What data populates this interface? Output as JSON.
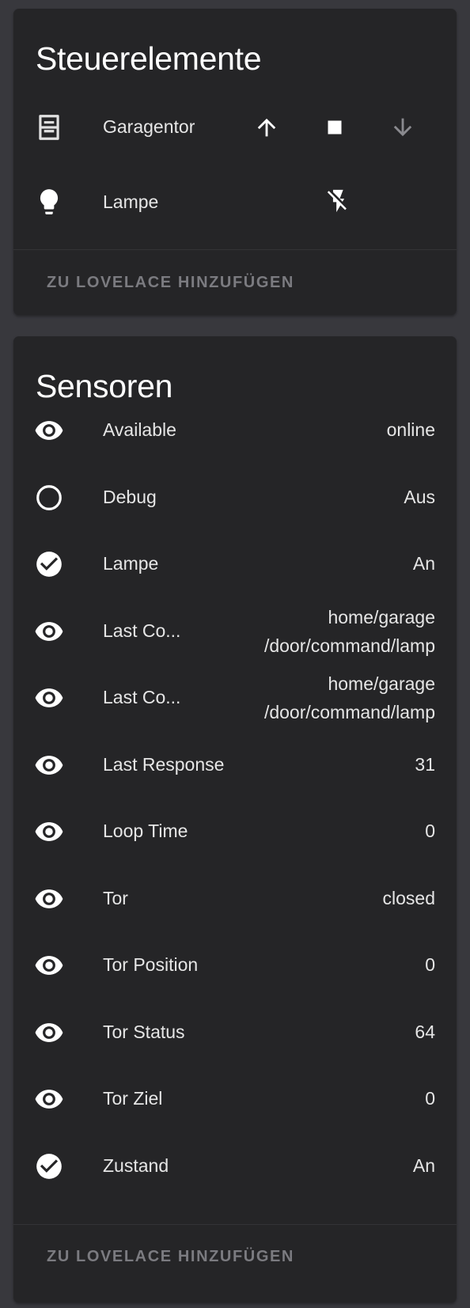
{
  "controls": {
    "title": "Steuerelemente",
    "items": [
      {
        "name": "Garagentor",
        "icon": "garage-door-icon"
      },
      {
        "name": "Lampe",
        "icon": "lightbulb-icon"
      }
    ],
    "footer_label": "ZU LOVELACE HINZUFÜGEN"
  },
  "sensors": {
    "title": "Sensoren",
    "items": [
      {
        "name": "Available",
        "value": "online",
        "icon": "eye-icon"
      },
      {
        "name": "Debug",
        "value": "Aus",
        "icon": "circle-outline-icon"
      },
      {
        "name": "Lampe",
        "value": "An",
        "icon": "check-circle-icon"
      },
      {
        "name": "Last Co...",
        "value": "home/garage\n/door/command/lamp",
        "icon": "eye-icon"
      },
      {
        "name": "Last Co...",
        "value": "home/garage\n/door/command/lamp",
        "icon": "eye-icon"
      },
      {
        "name": "Last Response",
        "value": "31",
        "icon": "eye-icon"
      },
      {
        "name": "Loop Time",
        "value": "0",
        "icon": "eye-icon"
      },
      {
        "name": "Tor",
        "value": "closed",
        "icon": "eye-icon"
      },
      {
        "name": "Tor Position",
        "value": "0",
        "icon": "eye-icon"
      },
      {
        "name": "Tor Status",
        "value": "64",
        "icon": "eye-icon"
      },
      {
        "name": "Tor Ziel",
        "value": "0",
        "icon": "eye-icon"
      },
      {
        "name": "Zustand",
        "value": "An",
        "icon": "check-circle-icon"
      }
    ],
    "footer_label": "ZU LOVELACE HINZUFÜGEN"
  }
}
